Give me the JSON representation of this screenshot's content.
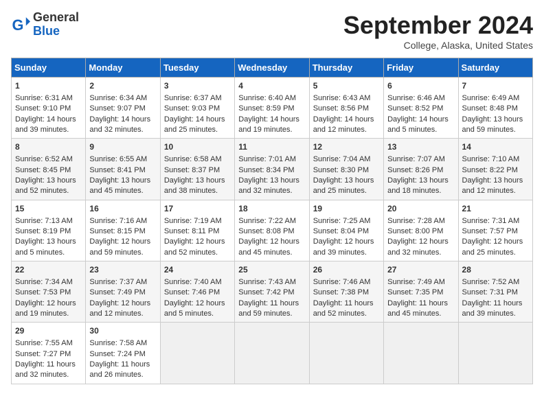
{
  "header": {
    "logo_general": "General",
    "logo_blue": "Blue",
    "title": "September 2024",
    "subtitle": "College, Alaska, United States"
  },
  "days_of_week": [
    "Sunday",
    "Monday",
    "Tuesday",
    "Wednesday",
    "Thursday",
    "Friday",
    "Saturday"
  ],
  "weeks": [
    [
      {
        "day": "1",
        "lines": [
          "Sunrise: 6:31 AM",
          "Sunset: 9:10 PM",
          "Daylight: 14 hours",
          "and 39 minutes."
        ]
      },
      {
        "day": "2",
        "lines": [
          "Sunrise: 6:34 AM",
          "Sunset: 9:07 PM",
          "Daylight: 14 hours",
          "and 32 minutes."
        ]
      },
      {
        "day": "3",
        "lines": [
          "Sunrise: 6:37 AM",
          "Sunset: 9:03 PM",
          "Daylight: 14 hours",
          "and 25 minutes."
        ]
      },
      {
        "day": "4",
        "lines": [
          "Sunrise: 6:40 AM",
          "Sunset: 8:59 PM",
          "Daylight: 14 hours",
          "and 19 minutes."
        ]
      },
      {
        "day": "5",
        "lines": [
          "Sunrise: 6:43 AM",
          "Sunset: 8:56 PM",
          "Daylight: 14 hours",
          "and 12 minutes."
        ]
      },
      {
        "day": "6",
        "lines": [
          "Sunrise: 6:46 AM",
          "Sunset: 8:52 PM",
          "Daylight: 14 hours",
          "and 5 minutes."
        ]
      },
      {
        "day": "7",
        "lines": [
          "Sunrise: 6:49 AM",
          "Sunset: 8:48 PM",
          "Daylight: 13 hours",
          "and 59 minutes."
        ]
      }
    ],
    [
      {
        "day": "8",
        "lines": [
          "Sunrise: 6:52 AM",
          "Sunset: 8:45 PM",
          "Daylight: 13 hours",
          "and 52 minutes."
        ]
      },
      {
        "day": "9",
        "lines": [
          "Sunrise: 6:55 AM",
          "Sunset: 8:41 PM",
          "Daylight: 13 hours",
          "and 45 minutes."
        ]
      },
      {
        "day": "10",
        "lines": [
          "Sunrise: 6:58 AM",
          "Sunset: 8:37 PM",
          "Daylight: 13 hours",
          "and 38 minutes."
        ]
      },
      {
        "day": "11",
        "lines": [
          "Sunrise: 7:01 AM",
          "Sunset: 8:34 PM",
          "Daylight: 13 hours",
          "and 32 minutes."
        ]
      },
      {
        "day": "12",
        "lines": [
          "Sunrise: 7:04 AM",
          "Sunset: 8:30 PM",
          "Daylight: 13 hours",
          "and 25 minutes."
        ]
      },
      {
        "day": "13",
        "lines": [
          "Sunrise: 7:07 AM",
          "Sunset: 8:26 PM",
          "Daylight: 13 hours",
          "and 18 minutes."
        ]
      },
      {
        "day": "14",
        "lines": [
          "Sunrise: 7:10 AM",
          "Sunset: 8:22 PM",
          "Daylight: 13 hours",
          "and 12 minutes."
        ]
      }
    ],
    [
      {
        "day": "15",
        "lines": [
          "Sunrise: 7:13 AM",
          "Sunset: 8:19 PM",
          "Daylight: 13 hours",
          "and 5 minutes."
        ]
      },
      {
        "day": "16",
        "lines": [
          "Sunrise: 7:16 AM",
          "Sunset: 8:15 PM",
          "Daylight: 12 hours",
          "and 59 minutes."
        ]
      },
      {
        "day": "17",
        "lines": [
          "Sunrise: 7:19 AM",
          "Sunset: 8:11 PM",
          "Daylight: 12 hours",
          "and 52 minutes."
        ]
      },
      {
        "day": "18",
        "lines": [
          "Sunrise: 7:22 AM",
          "Sunset: 8:08 PM",
          "Daylight: 12 hours",
          "and 45 minutes."
        ]
      },
      {
        "day": "19",
        "lines": [
          "Sunrise: 7:25 AM",
          "Sunset: 8:04 PM",
          "Daylight: 12 hours",
          "and 39 minutes."
        ]
      },
      {
        "day": "20",
        "lines": [
          "Sunrise: 7:28 AM",
          "Sunset: 8:00 PM",
          "Daylight: 12 hours",
          "and 32 minutes."
        ]
      },
      {
        "day": "21",
        "lines": [
          "Sunrise: 7:31 AM",
          "Sunset: 7:57 PM",
          "Daylight: 12 hours",
          "and 25 minutes."
        ]
      }
    ],
    [
      {
        "day": "22",
        "lines": [
          "Sunrise: 7:34 AM",
          "Sunset: 7:53 PM",
          "Daylight: 12 hours",
          "and 19 minutes."
        ]
      },
      {
        "day": "23",
        "lines": [
          "Sunrise: 7:37 AM",
          "Sunset: 7:49 PM",
          "Daylight: 12 hours",
          "and 12 minutes."
        ]
      },
      {
        "day": "24",
        "lines": [
          "Sunrise: 7:40 AM",
          "Sunset: 7:46 PM",
          "Daylight: 12 hours",
          "and 5 minutes."
        ]
      },
      {
        "day": "25",
        "lines": [
          "Sunrise: 7:43 AM",
          "Sunset: 7:42 PM",
          "Daylight: 11 hours",
          "and 59 minutes."
        ]
      },
      {
        "day": "26",
        "lines": [
          "Sunrise: 7:46 AM",
          "Sunset: 7:38 PM",
          "Daylight: 11 hours",
          "and 52 minutes."
        ]
      },
      {
        "day": "27",
        "lines": [
          "Sunrise: 7:49 AM",
          "Sunset: 7:35 PM",
          "Daylight: 11 hours",
          "and 45 minutes."
        ]
      },
      {
        "day": "28",
        "lines": [
          "Sunrise: 7:52 AM",
          "Sunset: 7:31 PM",
          "Daylight: 11 hours",
          "and 39 minutes."
        ]
      }
    ],
    [
      {
        "day": "29",
        "lines": [
          "Sunrise: 7:55 AM",
          "Sunset: 7:27 PM",
          "Daylight: 11 hours",
          "and 32 minutes."
        ]
      },
      {
        "day": "30",
        "lines": [
          "Sunrise: 7:58 AM",
          "Sunset: 7:24 PM",
          "Daylight: 11 hours",
          "and 26 minutes."
        ]
      },
      {
        "day": "",
        "lines": []
      },
      {
        "day": "",
        "lines": []
      },
      {
        "day": "",
        "lines": []
      },
      {
        "day": "",
        "lines": []
      },
      {
        "day": "",
        "lines": []
      }
    ]
  ]
}
